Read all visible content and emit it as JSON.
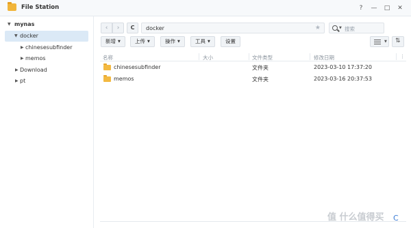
{
  "window": {
    "title": "File Station",
    "help_glyph": "?",
    "minimize_glyph": "—",
    "maximize_glyph": "□",
    "close_glyph": "✕"
  },
  "sidebar": {
    "root": "mynas",
    "items": [
      {
        "label": "docker",
        "expanded": true,
        "selected": true
      },
      {
        "label": "chinesesubfinder",
        "expanded": false
      },
      {
        "label": "memos",
        "expanded": false
      },
      {
        "label": "Download",
        "expanded": false
      },
      {
        "label": "pt",
        "expanded": false
      }
    ]
  },
  "toolbar": {
    "back_glyph": "‹",
    "forward_glyph": "›",
    "refresh_glyph": "C",
    "path": "docker",
    "star_glyph": "★",
    "search_placeholder": "搜索",
    "buttons": [
      "新增",
      "上传",
      "操作",
      "工具",
      "设置"
    ]
  },
  "file_list": {
    "columns": [
      "名称",
      "大小",
      "文件类型",
      "修改日期"
    ],
    "rows": [
      {
        "name": "chinesesubfinder",
        "size": "",
        "type": "文件夹",
        "modified": "2023-03-10 17:37:20"
      },
      {
        "name": "memos",
        "size": "",
        "type": "文件夹",
        "modified": "2023-03-16 20:37:53"
      }
    ]
  },
  "watermark": "值 什么值得买",
  "footer": {
    "refresh_glyph": "C"
  },
  "colors": {
    "selected_bg": "#dbe9f6",
    "folder": "#f3b941",
    "accent": "#3a7bd5"
  }
}
